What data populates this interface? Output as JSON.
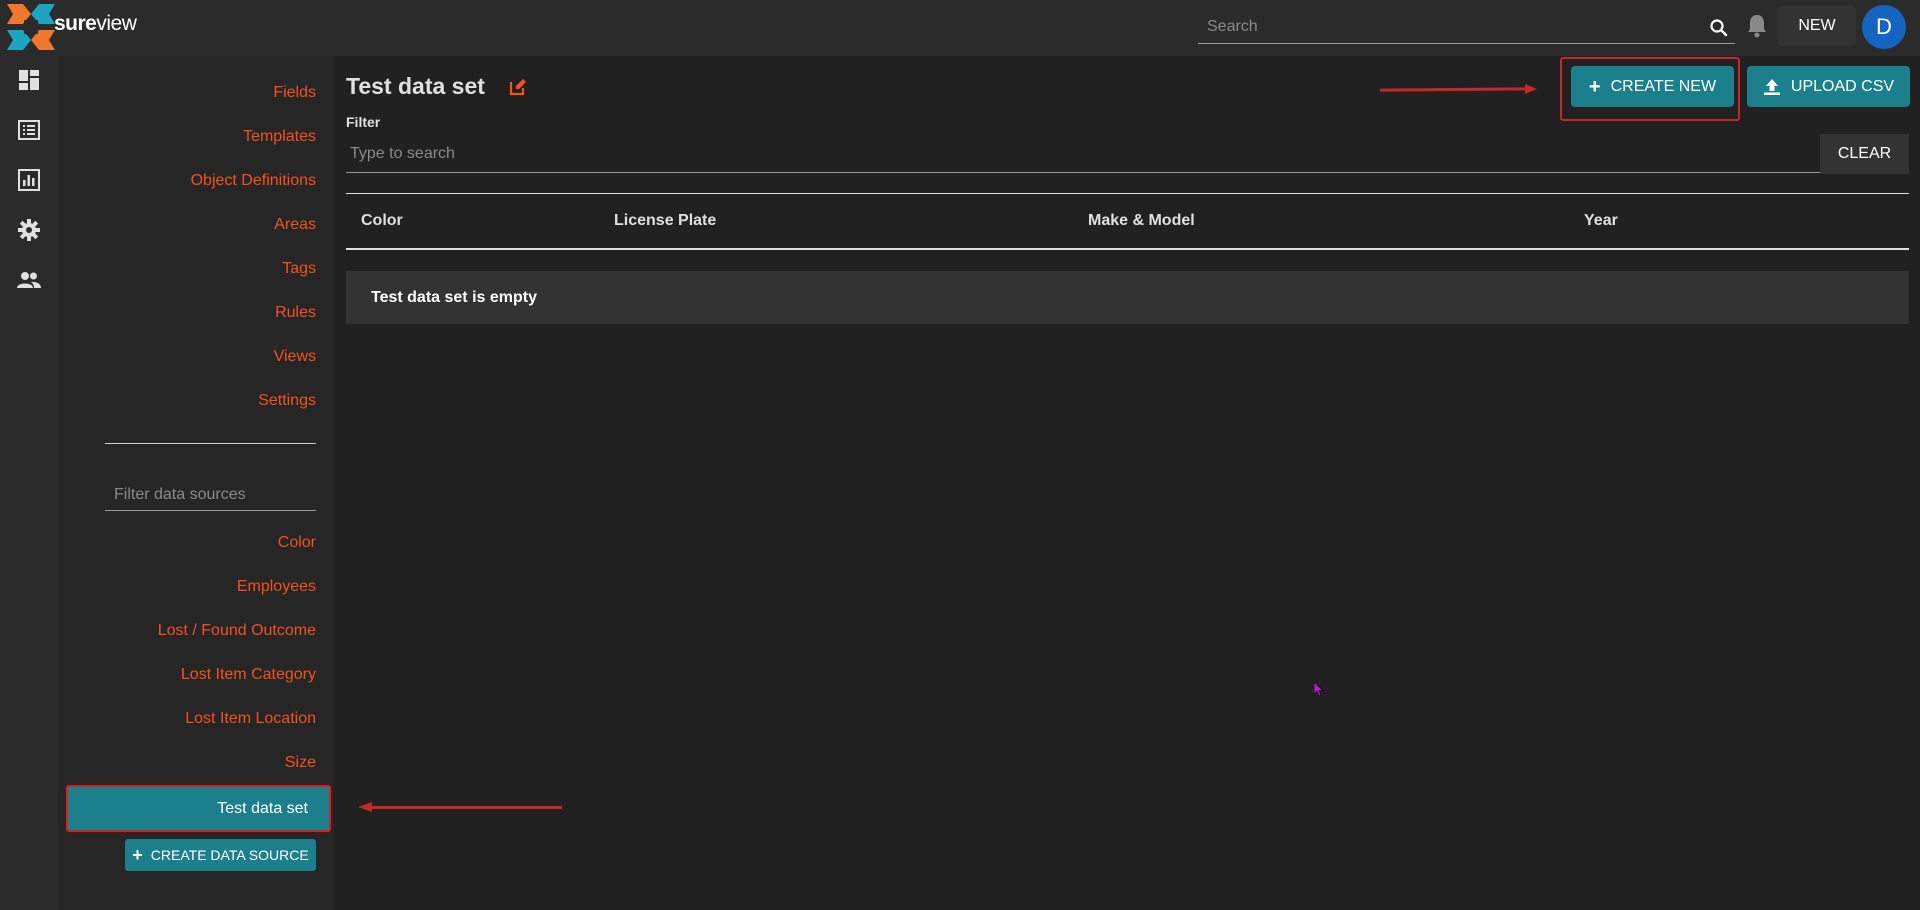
{
  "app": {
    "logo_text_bold": "sure",
    "logo_text_light": "view",
    "search_placeholder": "Search",
    "new_label": "NEW",
    "avatar_initial": "D",
    "accent_color": "#1c7f8c",
    "link_color": "#f4511e"
  },
  "rail": {
    "items": [
      "dashboard-icon",
      "list-icon",
      "chart-icon",
      "gear-icon",
      "people-icon"
    ]
  },
  "sidebar": {
    "items": [
      {
        "label": "Fields"
      },
      {
        "label": "Templates"
      },
      {
        "label": "Object Definitions"
      },
      {
        "label": "Areas"
      },
      {
        "label": "Tags"
      },
      {
        "label": "Rules"
      },
      {
        "label": "Views"
      },
      {
        "label": "Settings"
      }
    ],
    "filter_placeholder": "Filter data sources",
    "data_sources": [
      {
        "label": "Color"
      },
      {
        "label": "Employees"
      },
      {
        "label": "Lost / Found Outcome"
      },
      {
        "label": "Lost Item Category"
      },
      {
        "label": "Lost Item Location"
      },
      {
        "label": "Size"
      }
    ],
    "active_source": "Test data set",
    "create_label": "CREATE DATA SOURCE"
  },
  "main": {
    "title": "Test data set",
    "filter_label": "Filter",
    "filter_placeholder": "Type to search",
    "clear_label": "CLEAR",
    "create_label": "CREATE NEW",
    "upload_label": "UPLOAD CSV",
    "columns": [
      "Color",
      "License Plate",
      "Make & Model",
      "Year"
    ],
    "empty_message": "Test data set is empty"
  }
}
